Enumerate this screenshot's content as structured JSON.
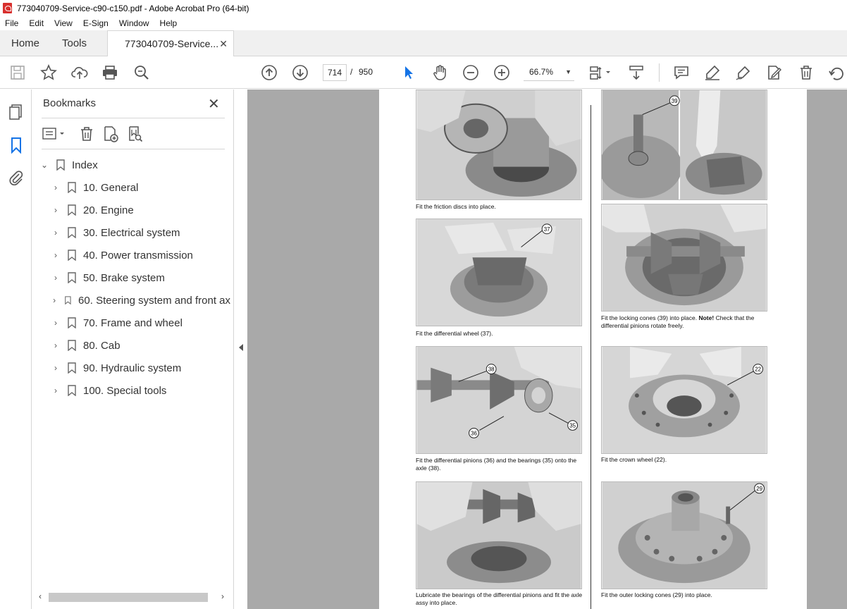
{
  "window": {
    "title": "773040709-Service-c90-c150.pdf - Adobe Acrobat Pro (64-bit)"
  },
  "menu": [
    "File",
    "Edit",
    "View",
    "E-Sign",
    "Window",
    "Help"
  ],
  "tabs": {
    "home": "Home",
    "tools": "Tools",
    "document": "773040709-Service..."
  },
  "toolbar": {
    "page_current": "714",
    "page_separator": "/",
    "page_total": "950",
    "zoom": "66.7%"
  },
  "bookmarks": {
    "title": "Bookmarks",
    "root": "Index",
    "items": [
      {
        "label": "10. General"
      },
      {
        "label": "20. Engine"
      },
      {
        "label": "30. Electrical system"
      },
      {
        "label": "40. Power transmission"
      },
      {
        "label": "50. Brake system"
      },
      {
        "label": "60. Steering system and front ax"
      },
      {
        "label": "70. Frame and wheel"
      },
      {
        "label": "80. Cab"
      },
      {
        "label": "90. Hydraulic system"
      },
      {
        "label": "100. Special tools"
      }
    ]
  },
  "page": {
    "captions": {
      "c1": "Fit the friction discs into place.",
      "c2": "Fit the differential wheel (37).",
      "c3": "Fit the differential pinions (36) and the bearings (35) onto the axle (38).",
      "c4": "Lubricate the bearings of the differential pinions and fit the axle assy into place.",
      "c5a": "Fit the locking cones (39) into place.",
      "c5b": "Note!",
      "c5c": "Check that the differential pinions rotate freely.",
      "c6": "Fit the crown wheel (22).",
      "c7": "Fit the outer locking cones (29) into place."
    },
    "callouts": {
      "n37": "37",
      "n38": "38",
      "n36": "36",
      "n35": "35",
      "n39": "39",
      "n22": "22",
      "n29": "29"
    }
  },
  "colors": {
    "pdf_red": "#d8302e",
    "accent_blue": "#1473e6",
    "doc_bg": "#a9a9a9"
  }
}
